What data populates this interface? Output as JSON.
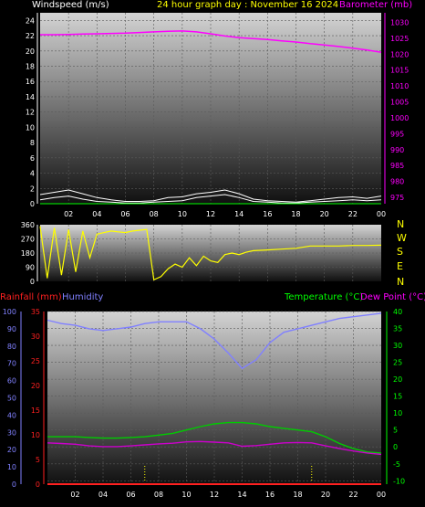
{
  "header": {
    "left_title": "Windspeed (m/s)",
    "center_title": "24 hour graph day : November 16 2024",
    "right_title": "Barometer (mb)"
  },
  "panel3_labels": {
    "rainfall": "Rainfall (mm)",
    "humidity": "Humidity",
    "temperature": "Temperature (°C)",
    "dewpoint": "Dew Point (°C)"
  },
  "compass": [
    "N",
    "W",
    "S",
    "E",
    "N"
  ],
  "colors": {
    "windspeed": "#ffffff",
    "gust": "#ffffff",
    "barometer": "#ff00ff",
    "direction": "#ffff00",
    "humidity": "#8080ff",
    "temperature": "#00cc00",
    "dewpoint": "#cc00cc",
    "rainfall": "#ff2020"
  },
  "chart_data": [
    {
      "type": "line",
      "name": "wind-barometer",
      "x_ticks": [
        "02",
        "04",
        "06",
        "08",
        "10",
        "12",
        "14",
        "16",
        "18",
        "20",
        "22",
        "00"
      ],
      "left_axis": {
        "label": "Windspeed (m/s)",
        "ticks": [
          0,
          2,
          4,
          6,
          8,
          10,
          12,
          14,
          16,
          18,
          20,
          22,
          24
        ],
        "ylim": [
          0,
          25
        ]
      },
      "right_axis": {
        "label": "Barometer (mb)",
        "ticks": [
          975,
          980,
          985,
          990,
          995,
          1000,
          1005,
          1010,
          1015,
          1020,
          1025,
          1030
        ],
        "ylim": [
          973,
          1033
        ]
      },
      "series": [
        {
          "name": "Barometer (mb)",
          "axis": "right",
          "x": [
            0,
            1,
            2,
            3,
            4,
            5,
            6,
            7,
            8,
            9,
            10,
            11,
            12,
            13,
            14,
            15,
            16,
            17,
            18,
            19,
            20,
            21,
            22,
            23,
            24
          ],
          "values": [
            1026.1,
            1026.1,
            1026.2,
            1026.3,
            1026.4,
            1026.5,
            1026.6,
            1026.8,
            1027.0,
            1027.2,
            1027.3,
            1027.0,
            1026.4,
            1025.7,
            1025.2,
            1024.9,
            1024.6,
            1024.2,
            1023.8,
            1023.3,
            1022.9,
            1022.4,
            1021.9,
            1021.3,
            1020.6
          ]
        },
        {
          "name": "Windspeed (m/s)",
          "axis": "left",
          "x": [
            0,
            1,
            2,
            3,
            4,
            5,
            6,
            7,
            8,
            9,
            10,
            11,
            12,
            13,
            14,
            15,
            16,
            17,
            18,
            19,
            20,
            21,
            22,
            23,
            24
          ],
          "values": [
            0.5,
            0.8,
            1.0,
            0.6,
            0.3,
            0.2,
            0.1,
            0.1,
            0.2,
            0.3,
            0.4,
            0.8,
            1.0,
            1.2,
            0.8,
            0.3,
            0.2,
            0.1,
            0.1,
            0.2,
            0.3,
            0.4,
            0.5,
            0.4,
            0.5
          ]
        },
        {
          "name": "Gust (m/s)",
          "axis": "left",
          "x": [
            0,
            1,
            2,
            3,
            4,
            5,
            6,
            7,
            8,
            9,
            10,
            11,
            12,
            13,
            14,
            15,
            16,
            17,
            18,
            19,
            20,
            21,
            22,
            23,
            24
          ],
          "values": [
            1.2,
            1.5,
            1.8,
            1.3,
            0.8,
            0.5,
            0.3,
            0.3,
            0.4,
            0.8,
            0.9,
            1.3,
            1.5,
            1.8,
            1.3,
            0.6,
            0.4,
            0.3,
            0.2,
            0.4,
            0.6,
            0.8,
            0.9,
            0.7,
            1.0
          ]
        }
      ]
    },
    {
      "type": "line",
      "name": "wind-direction",
      "x_ticks": [
        "02",
        "04",
        "06",
        "08",
        "10",
        "12",
        "14",
        "16",
        "18",
        "20",
        "22",
        "00"
      ],
      "left_axis": {
        "ticks": [
          0,
          90,
          180,
          270,
          360
        ],
        "ylim": [
          0,
          360
        ]
      },
      "series": [
        {
          "name": "Wind direction (deg)",
          "x": [
            0,
            0.5,
            1,
            1.5,
            2,
            2.5,
            3,
            3.5,
            4,
            4.5,
            5,
            5.5,
            6,
            6.5,
            7,
            7.5,
            8,
            8.5,
            9,
            9.5,
            10,
            10.5,
            11,
            11.5,
            12,
            12.5,
            13,
            13.5,
            14,
            14.5,
            15,
            16,
            17,
            18,
            19,
            20,
            21,
            22,
            23,
            24
          ],
          "values": [
            350,
            20,
            340,
            40,
            330,
            60,
            320,
            150,
            300,
            310,
            320,
            315,
            310,
            320,
            325,
            330,
            10,
            30,
            80,
            110,
            90,
            150,
            100,
            160,
            130,
            120,
            170,
            180,
            170,
            185,
            195,
            200,
            205,
            210,
            225,
            225,
            225,
            228,
            228,
            230
          ]
        }
      ]
    },
    {
      "type": "line",
      "name": "temp-humidity-rain",
      "x_ticks": [
        "02",
        "04",
        "06",
        "08",
        "10",
        "12",
        "14",
        "16",
        "18",
        "20",
        "22",
        "00"
      ],
      "humidity_axis": {
        "label": "Humidity",
        "ticks": [
          0,
          10,
          20,
          30,
          40,
          50,
          60,
          70,
          80,
          90,
          100
        ],
        "ylim": [
          0,
          100
        ]
      },
      "rain_axis": {
        "label": "Rainfall (mm)",
        "ticks": [
          0,
          5,
          10,
          15,
          20,
          25,
          30,
          35
        ],
        "ylim": [
          0,
          35
        ]
      },
      "temp_axis": {
        "label": "Temperature (°C)",
        "ticks": [
          -10,
          -5,
          0,
          5,
          10,
          15,
          20,
          25,
          30,
          35,
          40
        ],
        "ylim": [
          -11,
          40
        ]
      },
      "series": [
        {
          "name": "Humidity",
          "x": [
            0,
            1,
            2,
            3,
            4,
            5,
            6,
            7,
            8,
            9,
            10,
            11,
            12,
            13,
            14,
            15,
            16,
            17,
            18,
            19,
            20,
            21,
            22,
            23,
            24
          ],
          "values": [
            95,
            93,
            92,
            90,
            89,
            90,
            91,
            93,
            94,
            94,
            94,
            90,
            84,
            76,
            67,
            72,
            82,
            88,
            90,
            92,
            94,
            96,
            97,
            98,
            99
          ]
        },
        {
          "name": "Temperature (°C)",
          "x": [
            0,
            1,
            2,
            3,
            4,
            5,
            6,
            7,
            8,
            9,
            10,
            11,
            12,
            13,
            14,
            15,
            16,
            17,
            18,
            19,
            20,
            21,
            22,
            23,
            24
          ],
          "values": [
            3,
            3,
            3,
            2.8,
            2.6,
            2.6,
            2.8,
            3,
            3.5,
            4,
            5,
            6,
            6.8,
            7.2,
            7.2,
            6.8,
            6,
            5.5,
            5,
            4.5,
            3,
            1,
            -0.5,
            -1.5,
            -1.8
          ]
        },
        {
          "name": "Dew Point (°C)",
          "x": [
            0,
            1,
            2,
            3,
            4,
            5,
            6,
            7,
            8,
            9,
            10,
            11,
            12,
            13,
            14,
            15,
            16,
            17,
            18,
            19,
            20,
            21,
            22,
            23,
            24
          ],
          "values": [
            1.2,
            1,
            0.8,
            0.3,
            0.1,
            0.1,
            0.3,
            0.6,
            0.9,
            1.1,
            1.5,
            1.6,
            1.4,
            1.2,
            0.2,
            0.4,
            0.8,
            1.2,
            1.3,
            1.2,
            0.3,
            -0.5,
            -1.2,
            -1.8,
            -2.2
          ]
        },
        {
          "name": "Rainfall (mm)",
          "x": [
            0,
            24
          ],
          "values": [
            0,
            0
          ]
        }
      ]
    }
  ]
}
